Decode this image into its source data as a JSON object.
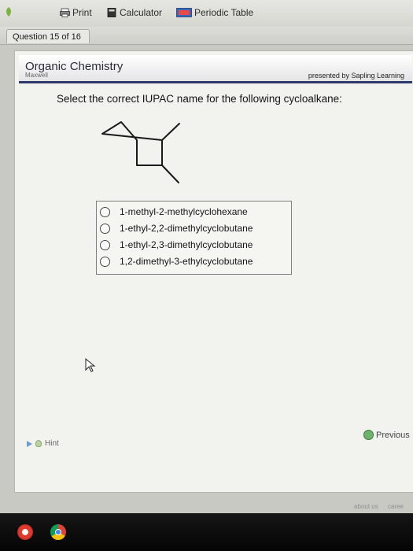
{
  "toolbar": {
    "items": [
      {
        "label": "Print",
        "icon": "printer-icon"
      },
      {
        "label": "Calculator",
        "icon": "calculator-icon"
      },
      {
        "label": "Periodic Table",
        "icon": "periodic-table-icon"
      }
    ]
  },
  "question_tab": {
    "label": "Question 15 of 16"
  },
  "header": {
    "course": "Organic Chemistry",
    "instructor": "Maxwell",
    "presented_by": "presented by Sapling Learning"
  },
  "question": {
    "prompt": "Select the correct IUPAC name for the following cycloalkane:",
    "options": [
      {
        "label": "1-methyl-2-methylcyclohexane",
        "selected": false
      },
      {
        "label": "1-ethyl-2,2-dimethylcyclobutane",
        "selected": false
      },
      {
        "label": "1-ethyl-2,3-dimethylcyclobutane",
        "selected": false
      },
      {
        "label": "1,2-dimethyl-3-ethylcyclobutane",
        "selected": false
      }
    ]
  },
  "navigation": {
    "previous_label": "Previous",
    "hint_label": "Hint"
  },
  "footer": {
    "links": [
      "about us",
      "caree"
    ]
  },
  "colors": {
    "header_accent": "#2e3a6c",
    "panel": "#f2f2ef",
    "dock": "#0a0a0a"
  }
}
